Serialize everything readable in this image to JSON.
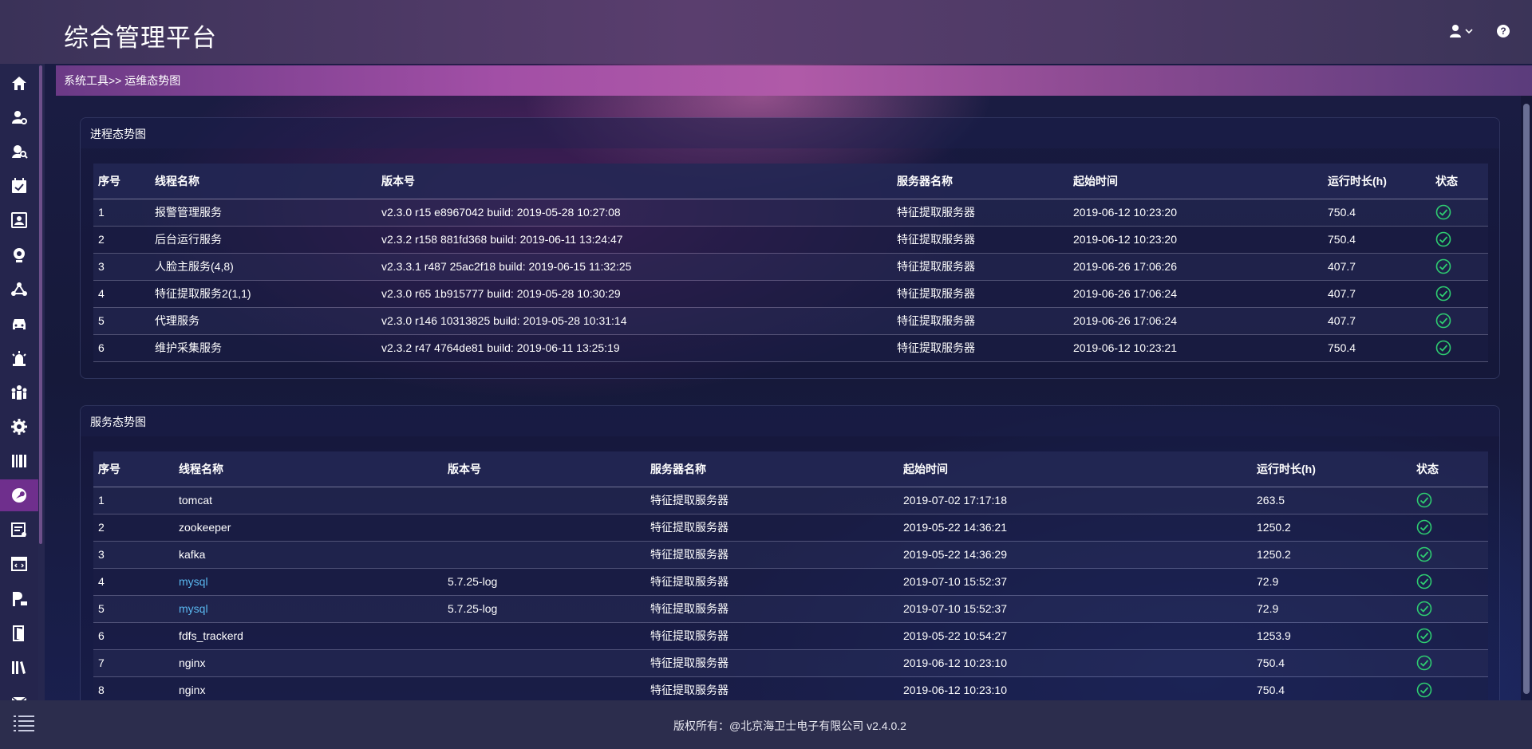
{
  "app": {
    "title": "综合管理平台"
  },
  "breadcrumb": "系统工具>> 运维态势图",
  "colors": {
    "accent": "#6f2f8d",
    "link": "#5ab8f0",
    "status_ok": "#2ecc71"
  },
  "sidebar": {
    "items": [
      {
        "icon": "home-icon"
      },
      {
        "icon": "user-settings-icon"
      },
      {
        "icon": "user-search-icon"
      },
      {
        "icon": "calendar-check-icon"
      },
      {
        "icon": "id-card-icon"
      },
      {
        "icon": "webcam-icon"
      },
      {
        "icon": "network-icon"
      },
      {
        "icon": "car-icon"
      },
      {
        "icon": "alarm-icon"
      },
      {
        "icon": "group-icon"
      },
      {
        "icon": "gear-icon"
      },
      {
        "icon": "barcode-icon"
      },
      {
        "icon": "wrench-icon",
        "active": true
      },
      {
        "icon": "log-icon"
      },
      {
        "icon": "code-window-icon"
      },
      {
        "icon": "parking-icon"
      },
      {
        "icon": "door-icon"
      },
      {
        "icon": "library-icon"
      },
      {
        "icon": "mail-icon"
      }
    ]
  },
  "process_panel": {
    "title": "进程态势图",
    "headers": [
      "序号",
      "线程名称",
      "版本号",
      "服务器名称",
      "起始时间",
      "运行时长(h)",
      "状态"
    ],
    "rows": [
      [
        "1",
        "报警管理服务",
        "v2.3.0 r15 e8967042 build: 2019-05-28 10:27:08",
        "特征提取服务器",
        "2019-06-12 10:23:20",
        "750.4"
      ],
      [
        "2",
        "后台运行服务",
        "v2.3.2 r158 881fd368 build: 2019-06-11 13:24:47",
        "特征提取服务器",
        "2019-06-12 10:23:20",
        "750.4"
      ],
      [
        "3",
        "人脸主服务(4,8)",
        "v2.3.3.1 r487 25ac2f18 build: 2019-06-15 11:32:25",
        "特征提取服务器",
        "2019-06-26 17:06:26",
        "407.7"
      ],
      [
        "4",
        "特征提取服务2(1,1)",
        "v2.3.0 r65 1b915777 build: 2019-05-28 10:30:29",
        "特征提取服务器",
        "2019-06-26 17:06:24",
        "407.7"
      ],
      [
        "5",
        "代理服务",
        "v2.3.0 r146 10313825 build: 2019-05-28 10:31:14",
        "特征提取服务器",
        "2019-06-26 17:06:24",
        "407.7"
      ],
      [
        "6",
        "维护采集服务",
        "v2.3.2 r47 4764de81 build: 2019-06-11 13:25:19",
        "特征提取服务器",
        "2019-06-12 10:23:21",
        "750.4"
      ]
    ]
  },
  "service_panel": {
    "title": "服务态势图",
    "headers": [
      "序号",
      "线程名称",
      "版本号",
      "服务器名称",
      "起始时间",
      "运行时长(h)",
      "状态"
    ],
    "rows": [
      [
        "1",
        "tomcat",
        "",
        "特征提取服务器",
        "2019-07-02 17:17:18",
        "263.5"
      ],
      [
        "2",
        "zookeeper",
        "",
        "特征提取服务器",
        "2019-05-22 14:36:21",
        "1250.2"
      ],
      [
        "3",
        "kafka",
        "",
        "特征提取服务器",
        "2019-05-22 14:36:29",
        "1250.2"
      ],
      [
        "4",
        "mysql",
        "5.7.25-log",
        "特征提取服务器",
        "2019-07-10 15:52:37",
        "72.9"
      ],
      [
        "5",
        "mysql",
        "5.7.25-log",
        "特征提取服务器",
        "2019-07-10 15:52:37",
        "72.9"
      ],
      [
        "6",
        "fdfs_trackerd",
        "",
        "特征提取服务器",
        "2019-05-22 10:54:27",
        "1253.9"
      ],
      [
        "7",
        "nginx",
        "",
        "特征提取服务器",
        "2019-06-12 10:23:10",
        "750.4"
      ],
      [
        "8",
        "nginx",
        "",
        "特征提取服务器",
        "2019-06-12 10:23:10",
        "750.4"
      ]
    ],
    "link_rows": [
      3,
      4
    ]
  },
  "footer": {
    "copyright": "版权所有：@北京海卫士电子有限公司 v2.4.0.2"
  }
}
